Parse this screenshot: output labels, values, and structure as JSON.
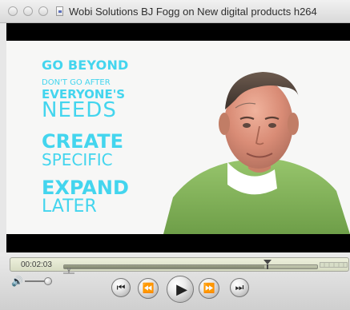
{
  "window": {
    "title": "Wobi Solutions BJ Fogg on New digital products h264"
  },
  "video": {
    "lines": {
      "go_beyond": "GO BEYOND",
      "dont_go_after": "DON'T GO AFTER",
      "everyones": "EVERYONE'S",
      "needs": "NEEDS",
      "create": "CREATE",
      "specific": "SPECIFIC",
      "expand": "EXPAND",
      "later": "LATER"
    }
  },
  "controls": {
    "time": "00:02:03",
    "progress_fraction": 0.79,
    "volume_fraction": 0.85,
    "icons": {
      "volume": "speaker-icon",
      "prev": "skip-back-icon",
      "rewind": "rewind-icon",
      "play": "play-icon",
      "forward": "fast-forward-icon",
      "next": "skip-forward-icon"
    }
  }
}
